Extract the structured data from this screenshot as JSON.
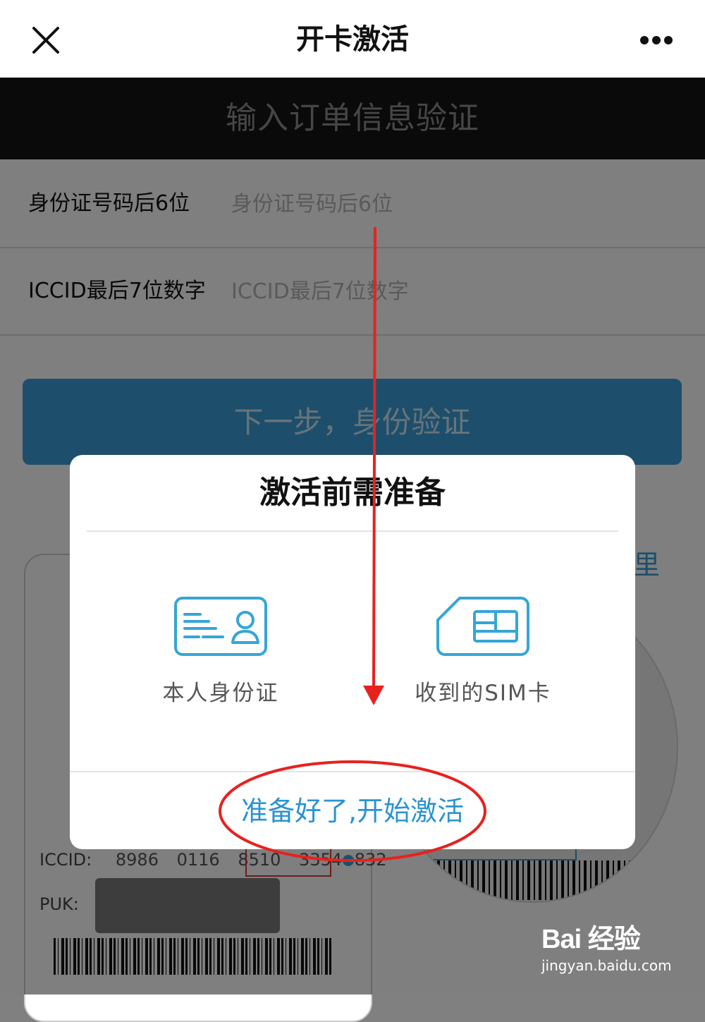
{
  "nav": {
    "title": "开卡激活",
    "close_icon": "close-icon",
    "more_icon": "more-dots-icon"
  },
  "header": {
    "title": "输入订单信息验证"
  },
  "form": {
    "id_label": "身份证号码后6位",
    "id_placeholder": "身份证号码后6位",
    "iccid_label": "ICCID最后7位数字",
    "iccid_placeholder": "ICCID最后7位数字",
    "next_button": "下一步，身份验证"
  },
  "background": {
    "help_link_partial": "这里",
    "iccid_label": "ICCID:",
    "iccid_groups": [
      "8986",
      "0116",
      "8510",
      "3354",
      "832"
    ],
    "puk_label": "PUK:"
  },
  "modal": {
    "title": "激活前需准备",
    "items": [
      {
        "label": "本人身份证",
        "icon": "id-card-icon"
      },
      {
        "label": "收到的SIM卡",
        "icon": "sim-card-icon"
      }
    ],
    "action": "准备好了,开始激活"
  },
  "annotation": {
    "arrow_color": "#e8211f",
    "ellipse_color": "#e8211f"
  },
  "watermark": {
    "logo": "Bai 经验",
    "url": "jingyan.baidu.com"
  },
  "colors": {
    "accent": "#2b93d1",
    "header_bg": "#141414"
  }
}
